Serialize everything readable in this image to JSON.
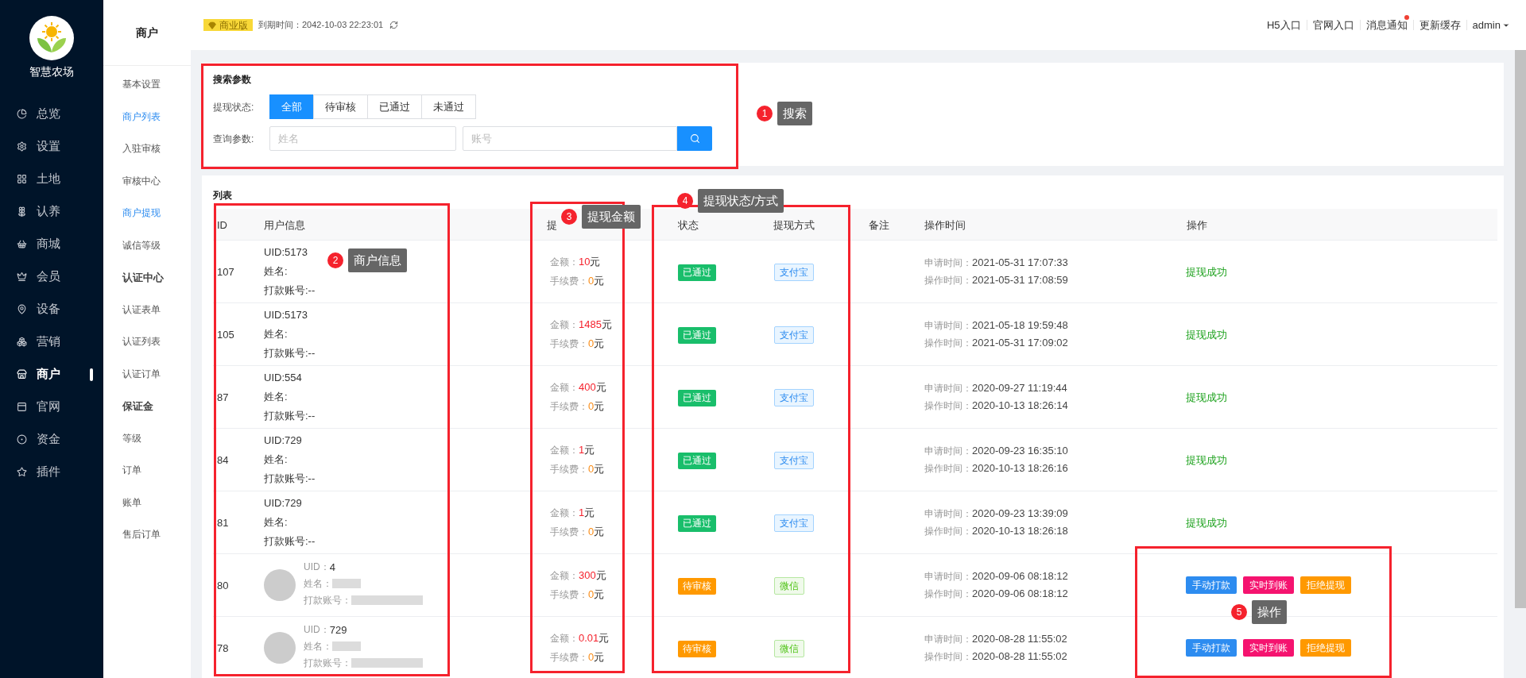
{
  "brand": {
    "name": "智慧农场"
  },
  "nav": [
    {
      "label": "总览",
      "selected": false
    },
    {
      "label": "设置",
      "selected": false
    },
    {
      "label": "土地",
      "selected": false
    },
    {
      "label": "认养",
      "selected": false
    },
    {
      "label": "商城",
      "selected": false
    },
    {
      "label": "会员",
      "selected": false
    },
    {
      "label": "设备",
      "selected": false
    },
    {
      "label": "营销",
      "selected": false
    },
    {
      "label": "商户",
      "selected": true
    },
    {
      "label": "官网",
      "selected": false
    },
    {
      "label": "资金",
      "selected": false
    },
    {
      "label": "插件",
      "selected": false
    }
  ],
  "submenu": {
    "title": "商户",
    "items": [
      {
        "kind": "link",
        "label": "基本设置",
        "selected": false
      },
      {
        "kind": "link",
        "label": "商户列表",
        "selected": true
      },
      {
        "kind": "link",
        "label": "入驻审核",
        "selected": false
      },
      {
        "kind": "link",
        "label": "审核中心",
        "selected": false
      },
      {
        "kind": "link",
        "label": "商户提现",
        "selected": true
      },
      {
        "kind": "link",
        "label": "诚信等级",
        "selected": false
      },
      {
        "kind": "heading",
        "label": "认证中心"
      },
      {
        "kind": "link",
        "label": "认证表单",
        "selected": false
      },
      {
        "kind": "link",
        "label": "认证列表",
        "selected": false
      },
      {
        "kind": "link",
        "label": "认证订单",
        "selected": false
      },
      {
        "kind": "heading",
        "label": "保证金"
      },
      {
        "kind": "link",
        "label": "等级",
        "selected": false
      },
      {
        "kind": "link",
        "label": "订单",
        "selected": false
      },
      {
        "kind": "link",
        "label": "账单",
        "selected": false
      },
      {
        "kind": "link",
        "label": "售后订单",
        "selected": false
      }
    ]
  },
  "topbar": {
    "edition": "商业版",
    "expiry": "到期时间：2042-10-03 22:23:01",
    "links": [
      {
        "label": "H5入口",
        "dot": false
      },
      {
        "label": "官网入口",
        "dot": false
      },
      {
        "label": "消息通知",
        "dot": true
      },
      {
        "label": "更新缓存",
        "dot": false
      }
    ],
    "user": "admin"
  },
  "search": {
    "title": "搜索参数",
    "status_label": "提现状态:",
    "tabs": [
      {
        "label": "全部",
        "selected": true
      },
      {
        "label": "待审核",
        "selected": false
      },
      {
        "label": "已通过",
        "selected": false
      },
      {
        "label": "未通过",
        "selected": false
      }
    ],
    "query_label": "查询参数:",
    "fields": [
      {
        "placeholder": "姓名"
      },
      {
        "placeholder": "账号"
      }
    ]
  },
  "list": {
    "title": "列表",
    "columns": [
      "ID",
      "用户信息",
      "提",
      "状态",
      "提现方式",
      "备注",
      "操作时间",
      "操作"
    ],
    "rows": [
      {
        "id": "107",
        "user": {
          "kind": "plain",
          "lines": [
            "UID:5173",
            "姓名:",
            "打款账号:--"
          ]
        },
        "amount_label": "金额：",
        "amount": "10",
        "unit": "元",
        "fee_label": "手续费：",
        "fee": "0",
        "fee_unit": "元",
        "status": {
          "label": "已通过",
          "color": "#19be6b"
        },
        "method": {
          "kind": "alipay",
          "label": "支付宝"
        },
        "apply_label": "申请时间：",
        "apply": "2021-05-31 17:07:33",
        "op_label": "操作时间：",
        "op": "2021-05-31 17:08:59",
        "action": {
          "kind": "done",
          "text": "提现成功"
        }
      },
      {
        "id": "105",
        "user": {
          "kind": "plain",
          "lines": [
            "UID:5173",
            "姓名:",
            "打款账号:--"
          ]
        },
        "amount_label": "金额：",
        "amount": "1485",
        "unit": "元",
        "fee_label": "手续费：",
        "fee": "0",
        "fee_unit": "元",
        "status": {
          "label": "已通过",
          "color": "#19be6b"
        },
        "method": {
          "kind": "alipay",
          "label": "支付宝"
        },
        "apply_label": "申请时间：",
        "apply": "2021-05-18 19:59:48",
        "op_label": "操作时间：",
        "op": "2021-05-31 17:09:02",
        "action": {
          "kind": "done",
          "text": "提现成功"
        }
      },
      {
        "id": "87",
        "user": {
          "kind": "plain",
          "lines": [
            "UID:554",
            "姓名:",
            "打款账号:--"
          ]
        },
        "amount_label": "金额：",
        "amount": "400",
        "unit": "元",
        "fee_label": "手续费：",
        "fee": "0",
        "fee_unit": "元",
        "status": {
          "label": "已通过",
          "color": "#19be6b"
        },
        "method": {
          "kind": "alipay",
          "label": "支付宝"
        },
        "apply_label": "申请时间：",
        "apply": "2020-09-27 11:19:44",
        "op_label": "操作时间：",
        "op": "2020-10-13 18:26:14",
        "action": {
          "kind": "done",
          "text": "提现成功"
        }
      },
      {
        "id": "84",
        "user": {
          "kind": "plain",
          "lines": [
            "UID:729",
            "姓名:",
            "打款账号:--"
          ]
        },
        "amount_label": "金额：",
        "amount": "1",
        "unit": "元",
        "fee_label": "手续费：",
        "fee": "0",
        "fee_unit": "元",
        "status": {
          "label": "已通过",
          "color": "#19be6b"
        },
        "method": {
          "kind": "alipay",
          "label": "支付宝"
        },
        "apply_label": "申请时间：",
        "apply": "2020-09-23 16:35:10",
        "op_label": "操作时间：",
        "op": "2020-10-13 18:26:16",
        "action": {
          "kind": "done",
          "text": "提现成功"
        }
      },
      {
        "id": "81",
        "user": {
          "kind": "plain",
          "lines": [
            "UID:729",
            "姓名:",
            "打款账号:--"
          ]
        },
        "amount_label": "金额：",
        "amount": "1",
        "unit": "元",
        "fee_label": "手续费：",
        "fee": "0",
        "fee_unit": "元",
        "status": {
          "label": "已通过",
          "color": "#19be6b"
        },
        "method": {
          "kind": "alipay",
          "label": "支付宝"
        },
        "apply_label": "申请时间：",
        "apply": "2020-09-23 13:39:09",
        "op_label": "操作时间：",
        "op": "2020-10-13 18:26:18",
        "action": {
          "kind": "done",
          "text": "提现成功"
        }
      },
      {
        "id": "80",
        "user": {
          "kind": "avatar",
          "fields": [
            {
              "label": "UID：",
              "value": "4"
            },
            {
              "label": "姓名：",
              "redacted": true
            },
            {
              "label": "打款账号：",
              "redacted": true
            }
          ]
        },
        "amount_label": "金额：",
        "amount": "300",
        "unit": "元",
        "fee_label": "手续费：",
        "fee": "0",
        "fee_unit": "元",
        "status": {
          "label": "待审核",
          "color": "#ff9900"
        },
        "method": {
          "kind": "wechat",
          "label": "微信"
        },
        "apply_label": "申请时间：",
        "apply": "2020-09-06 08:18:12",
        "op_label": "操作时间：",
        "op": "2020-09-06 08:18:12",
        "action": {
          "kind": "buttons",
          "buttons": [
            {
              "label": "手动打款",
              "color": "#2d8cf0"
            },
            {
              "label": "实时到账",
              "color": "#f5136f"
            },
            {
              "label": "拒绝提现",
              "color": "#ff9900"
            }
          ]
        }
      },
      {
        "id": "78",
        "user": {
          "kind": "avatar",
          "fields": [
            {
              "label": "UID：",
              "value": "729"
            },
            {
              "label": "姓名：",
              "redacted": true
            },
            {
              "label": "打款账号：",
              "redacted": true
            }
          ]
        },
        "amount_label": "金额：",
        "amount": "0.01",
        "unit": "元",
        "fee_label": "手续费：",
        "fee": "0",
        "fee_unit": "元",
        "status": {
          "label": "待审核",
          "color": "#ff9900"
        },
        "method": {
          "kind": "wechat",
          "label": "微信"
        },
        "apply_label": "申请时间：",
        "apply": "2020-08-28 11:55:02",
        "op_label": "操作时间：",
        "op": "2020-08-28 11:55:02",
        "action": {
          "kind": "buttons",
          "buttons": [
            {
              "label": "手动打款",
              "color": "#2d8cf0"
            },
            {
              "label": "实时到账",
              "color": "#f5136f"
            },
            {
              "label": "拒绝提现",
              "color": "#ff9900"
            }
          ]
        }
      }
    ]
  },
  "annotations": [
    {
      "number": "1",
      "label": "搜索"
    },
    {
      "number": "2",
      "label": "商户信息"
    },
    {
      "number": "3",
      "label": "提现金额"
    },
    {
      "number": "4",
      "label": "提现状态/方式"
    },
    {
      "number": "5",
      "label": "操作"
    }
  ]
}
